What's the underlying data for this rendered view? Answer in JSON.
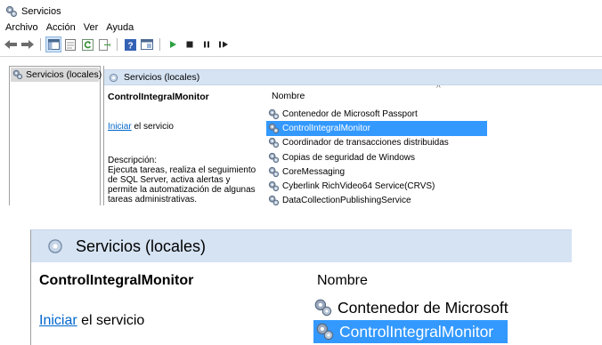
{
  "window": {
    "title": "Servicios",
    "icon": "services-gear-icon"
  },
  "menu": [
    "Archivo",
    "Acción",
    "Ver",
    "Ayuda"
  ],
  "toolbar": {
    "buttons": [
      "back-arrow-icon",
      "forward-arrow-icon",
      "console-tree-icon",
      "properties-icon",
      "refresh-icon",
      "export-list-icon",
      "help-icon",
      "view-icon",
      "play-icon",
      "stop-icon",
      "pause-icon",
      "resume-icon"
    ]
  },
  "tree": {
    "item": "Servicios (locales)"
  },
  "panel": {
    "header": "Servicios (locales)",
    "service_name": "ControlIntegralMonitor",
    "start_link": "Iniciar",
    "start_suffix": " el servicio",
    "description_label": "Descripción:",
    "description": "Ejecuta tareas, realiza el seguimiento de SQL Server, activa alertas y permite la automatización de algunas tareas administrativas."
  },
  "list": {
    "column": "Nombre",
    "sort_indicator": "^",
    "rows": [
      {
        "name": "Contenedor de Microsoft Passport",
        "selected": false
      },
      {
        "name": "ControlIntegralMonitor",
        "selected": true
      },
      {
        "name": "Coordinador de transacciones distribuidas",
        "selected": false
      },
      {
        "name": "Copias de seguridad de Windows",
        "selected": false
      },
      {
        "name": "CoreMessaging",
        "selected": false
      },
      {
        "name": "Cyberlink RichVideo64 Service(CRVS)",
        "selected": false
      },
      {
        "name": "DataCollectionPublishingService",
        "selected": false
      }
    ]
  },
  "zoom": {
    "header": "Servicios (locales)",
    "service_name": "ControlIntegralMonitor",
    "start_link": "Iniciar",
    "start_suffix": " el servicio",
    "column": "Nombre",
    "row1": "Contenedor de Microsoft",
    "row2": "ControlIntegralMonitor"
  },
  "colors": {
    "selection": "#3399ff",
    "header_bg": "#d6e3f3",
    "link": "#0066cc"
  }
}
